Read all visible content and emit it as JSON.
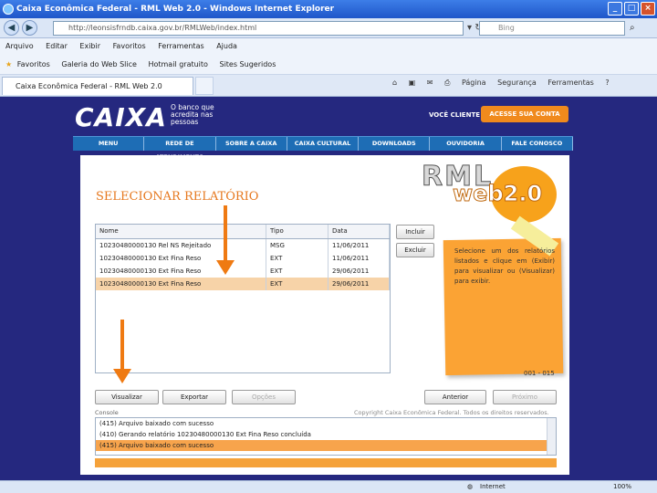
{
  "window": {
    "title": "Caixa Econômica Federal - RML Web 2.0 - Windows Internet Explorer"
  },
  "address": {
    "url": "http://leonsisfrndb.caixa.gov.br/RMLWeb/index.html",
    "search_placeholder": "Bing"
  },
  "menu": [
    "Arquivo",
    "Editar",
    "Exibir",
    "Favoritos",
    "Ferramentas",
    "Ajuda"
  ],
  "favorites": {
    "label": "Favoritos",
    "items": [
      "Galeria do Web Slice",
      "Hotmail gratuito",
      "Sites Sugeridos"
    ]
  },
  "tab": {
    "label": "Caixa Econômica Federal - RML Web 2.0"
  },
  "commandbar": [
    "Página",
    "Segurança",
    "Ferramentas"
  ],
  "site": {
    "logo": "CAIXA",
    "tagline": "O banco que acredita nas pessoas",
    "voce_cliente": "VOCÊ CLIENTE",
    "acesse": "ACESSE SUA CONTA",
    "nav": [
      "MENU",
      "REDE DE ATENDIMENTO",
      "SOBRE A CAIXA",
      "CAIXA CULTURAL",
      "DOWNLOADS",
      "OUVIDORIA",
      "FALE CONOSCO"
    ],
    "rml_logo": "RML",
    "web_logo": "web2.0"
  },
  "report": {
    "title": "SELECIONAR RELATÓRIO",
    "columns": [
      "Nome",
      "Tipo",
      "Data"
    ],
    "rows": [
      {
        "nome": "10230480000130 Rel NS Rejeitado",
        "tipo": "MSG",
        "data": "11/06/2011"
      },
      {
        "nome": "10230480000130 Ext Fina Reso",
        "tipo": "EXT",
        "data": "11/06/2011"
      },
      {
        "nome": "10230480000130 Ext Fina Reso",
        "tipo": "EXT",
        "data": "29/06/2011"
      },
      {
        "nome": "10230480000130 Ext Fina Reso",
        "tipo": "EXT",
        "data": "29/06/2011"
      }
    ],
    "selected_row": 3,
    "side_buttons": [
      "Incluir",
      "Excluir"
    ],
    "note": "Selecione um dos relatórios listados e clique em (Exibir) para visualizar ou (Visualizar) para exibir.",
    "page_counter": "001 - 015",
    "buttons": {
      "visualizar": "Visualizar",
      "exportar": "Exportar",
      "opcoes": "Opções",
      "anterior": "Anterior",
      "proximo": "Próximo"
    }
  },
  "console": {
    "label": "Console",
    "copyright": "Copyright Caixa Econômica Federal. Todos os direitos reservados.",
    "lines": [
      "(415) Arquivo baixado com sucesso",
      "(410) Gerando relatório 10230480000130 Ext Fina Reso concluída",
      "(415) Arquivo baixado com sucesso"
    ]
  },
  "status": {
    "zone": "Internet",
    "zoom": "100%"
  },
  "colors": {
    "accent": "#ef7a12",
    "background": "#25287f",
    "nav": "#1e6db5"
  }
}
